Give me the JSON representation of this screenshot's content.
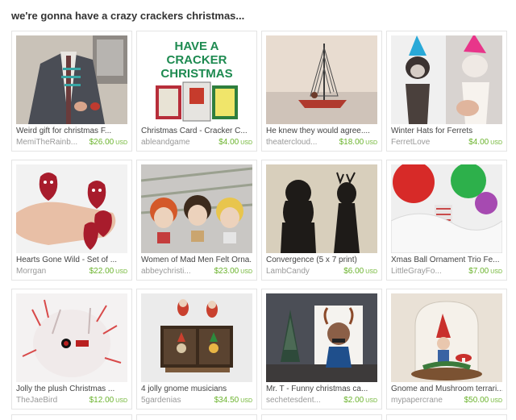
{
  "page": {
    "title": "we're gonna have a crazy crackers christmas..."
  },
  "items": [
    {
      "title": "Weird gift for christmas F...",
      "shop": "MemiTheRainb...",
      "price": "$26.00",
      "currency": "USD"
    },
    {
      "title": "Christmas Card - Cracker C...",
      "shop": "ableandgame",
      "price": "$4.00",
      "currency": "USD",
      "image_text": [
        "HAVE A",
        "CRACKER",
        "CHRISTMAS"
      ]
    },
    {
      "title": "He knew they would agree....",
      "shop": "theatercloud...",
      "price": "$18.00",
      "currency": "USD"
    },
    {
      "title": "Winter Hats for Ferrets",
      "shop": "FerretLove",
      "price": "$4.00",
      "currency": "USD"
    },
    {
      "title": "Hearts Gone Wild - Set of ...",
      "shop": "Morrgan",
      "price": "$22.00",
      "currency": "USD"
    },
    {
      "title": "Women of Mad Men Felt Orna...",
      "shop": "abbeychristi...",
      "price": "$23.00",
      "currency": "USD"
    },
    {
      "title": "Convergence (5 x 7 print)",
      "shop": "LambCandy",
      "price": "$6.00",
      "currency": "USD"
    },
    {
      "title": "Xmas Ball Ornament Trio Fe...",
      "shop": "LittleGrayFo...",
      "price": "$7.00",
      "currency": "USD"
    },
    {
      "title": "Jolly the plush Christmas ...",
      "shop": "TheJaeBird",
      "price": "$12.00",
      "currency": "USD"
    },
    {
      "title": "4 jolly gnome musicians",
      "shop": "5gardenias",
      "price": "$34.50",
      "currency": "USD"
    },
    {
      "title": "Mr. T - Funny christmas ca...",
      "shop": "sechetesdent...",
      "price": "$2.00",
      "currency": "USD"
    },
    {
      "title": "Gnome and Mushroom terrari...",
      "shop": "mypapercrane",
      "price": "$50.00",
      "currency": "USD"
    }
  ],
  "colors": {
    "price": "#6bb32d",
    "shop": "#999999",
    "border": "#e4e4e4"
  }
}
